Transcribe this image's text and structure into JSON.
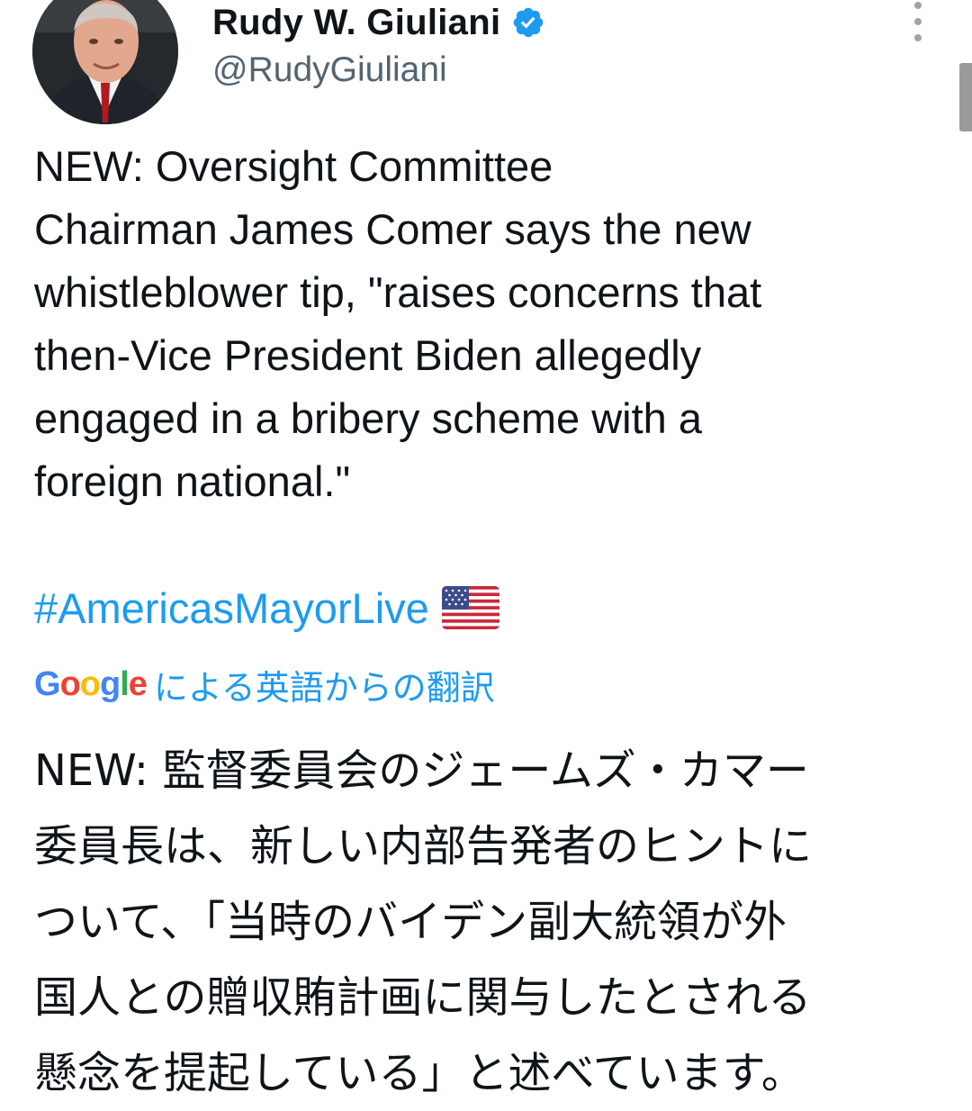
{
  "author": {
    "display_name": "Rudy W. Giuliani",
    "handle": "@RudyGiuliani",
    "verified": true,
    "avatar": "profile-photo-man-suit"
  },
  "tweet": {
    "text": "NEW: Oversight Committee\nChairman James Comer says the new\nwhistleblower tip, \"raises concerns that\nthen-Vice President Biden allegedly\nengaged in a bribery scheme with a\nforeign national.\"",
    "hashtag": "#AmericasMayorLive",
    "hashtag_emoji": "us-flag"
  },
  "translation": {
    "provider_logo": "Google",
    "label": "による英語からの翻訳",
    "text": "NEW: 監督委員会のジェームズ・カマー\n委員長は、新しい内部告発者のヒントに\nついて、「当時のバイデン副大統領が外\n国人との贈収賄計画に関与したとされる\n懸念を提起している」と述べています。"
  },
  "colors": {
    "link": "#1d9bf0",
    "text": "#0f1419",
    "secondary": "#536471",
    "verified": "#1d9bf0"
  },
  "icons": {
    "verified": "verified-badge-icon",
    "more": "more-vertical-icon"
  }
}
